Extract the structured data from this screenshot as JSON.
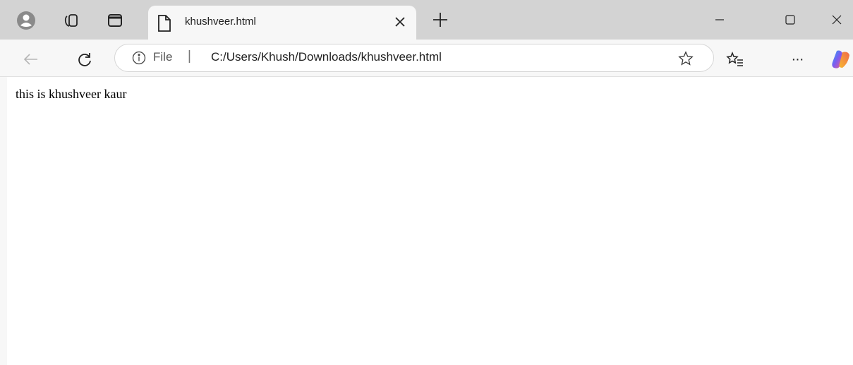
{
  "tab": {
    "title": "khushveer.html"
  },
  "addressbar": {
    "scheme_label": "File",
    "separator": "|",
    "url": "C:/Users/Khush/Downloads/khushveer.html"
  },
  "toolbar": {
    "more_label": "···"
  },
  "page": {
    "text": "this is khushveer kaur"
  },
  "icons": {
    "profile": "profile-icon",
    "workspaces": "workspaces-icon",
    "vertical_tabs": "vertical-tabs-icon",
    "document": "document-icon",
    "close": "close-icon",
    "new_tab": "plus-icon",
    "minimize": "minimize-icon",
    "maximize": "maximize-icon",
    "window_close": "close-icon",
    "back": "back-arrow-icon",
    "refresh": "refresh-icon",
    "info": "info-icon",
    "favorite": "star-icon",
    "favorites": "favorites-icon",
    "copilot": "copilot-icon"
  },
  "colors": {
    "titlebar": "#d3d3d3",
    "toolbar": "#f7f7f7",
    "tab_active": "#f7f7f7",
    "page_bg": "#ffffff"
  }
}
